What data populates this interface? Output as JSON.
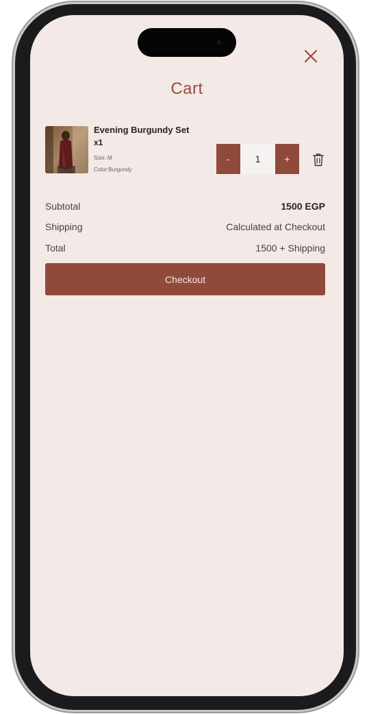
{
  "screen": {
    "title": "Cart",
    "background_color": "#f3e9e6",
    "accent_color": "#8f4a3b"
  },
  "header": {
    "close_icon": "close-icon"
  },
  "cart_items": [
    {
      "name": "Evening Burgundy Set",
      "quantity_label": "x1",
      "size": "Size: M",
      "color": "Color:Burgundy",
      "quantity": "1",
      "decrement_label": "-",
      "increment_label": "+",
      "delete_icon": "trash-icon"
    }
  ],
  "summary": {
    "subtotal_label": "Subtotal",
    "subtotal_value": "1500 EGP",
    "shipping_label": "Shipping",
    "shipping_value": "Calculated at Checkout",
    "total_label": "Total",
    "total_value": "1500 + Shipping"
  },
  "checkout": {
    "button_label": "Checkout"
  }
}
